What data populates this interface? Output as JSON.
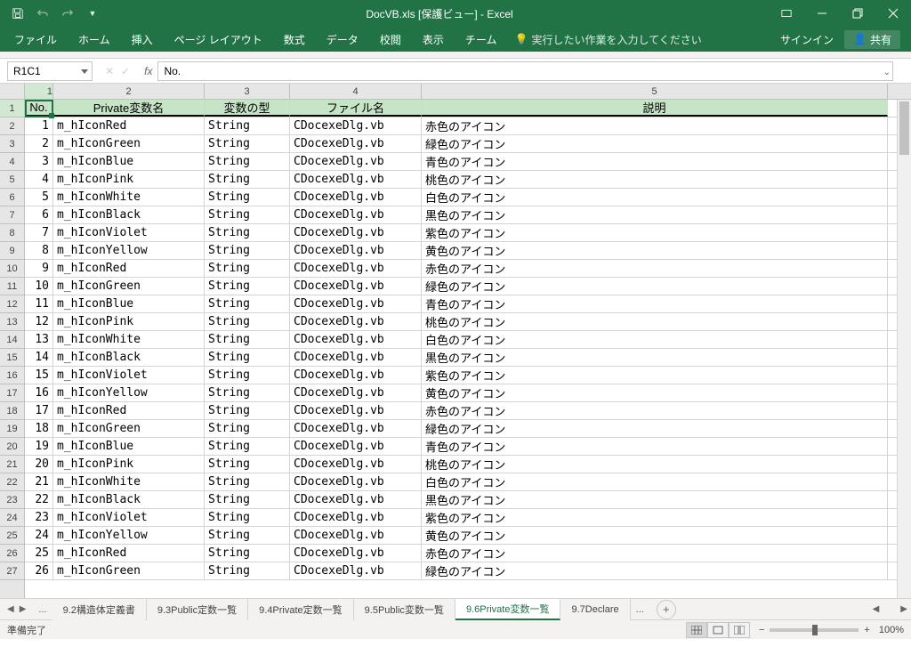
{
  "titlebar": {
    "title": "DocVB.xls [保護ビュー] - Excel"
  },
  "ribbon": {
    "tabs": [
      "ファイル",
      "ホーム",
      "挿入",
      "ページ レイアウト",
      "数式",
      "データ",
      "校閲",
      "表示",
      "チーム"
    ],
    "tell_me_placeholder": "実行したい作業を入力してください",
    "signin": "サインイン",
    "share": "共有"
  },
  "formula_bar": {
    "name_box": "R1C1",
    "formula": "No."
  },
  "grid": {
    "col_numbers": [
      "1",
      "2",
      "3",
      "4",
      "5"
    ],
    "headers": [
      "No.",
      "Private変数名",
      "変数の型",
      "ファイル名",
      "説明"
    ],
    "rows": [
      {
        "no": "1",
        "name": "m_hIconRed",
        "type": "String",
        "file": "CDocexeDlg.vb",
        "desc": "赤色のアイコン"
      },
      {
        "no": "2",
        "name": "m_hIconGreen",
        "type": "String",
        "file": "CDocexeDlg.vb",
        "desc": "緑色のアイコン"
      },
      {
        "no": "3",
        "name": "m_hIconBlue",
        "type": "String",
        "file": "CDocexeDlg.vb",
        "desc": "青色のアイコン"
      },
      {
        "no": "4",
        "name": "m_hIconPink",
        "type": "String",
        "file": "CDocexeDlg.vb",
        "desc": "桃色のアイコン"
      },
      {
        "no": "5",
        "name": "m_hIconWhite",
        "type": "String",
        "file": "CDocexeDlg.vb",
        "desc": "白色のアイコン"
      },
      {
        "no": "6",
        "name": "m_hIconBlack",
        "type": "String",
        "file": "CDocexeDlg.vb",
        "desc": "黒色のアイコン"
      },
      {
        "no": "7",
        "name": "m_hIconViolet",
        "type": "String",
        "file": "CDocexeDlg.vb",
        "desc": "紫色のアイコン"
      },
      {
        "no": "8",
        "name": "m_hIconYellow",
        "type": "String",
        "file": "CDocexeDlg.vb",
        "desc": "黄色のアイコン"
      },
      {
        "no": "9",
        "name": "m_hIconRed",
        "type": "String",
        "file": "CDocexeDlg.vb",
        "desc": "赤色のアイコン"
      },
      {
        "no": "10",
        "name": "m_hIconGreen",
        "type": "String",
        "file": "CDocexeDlg.vb",
        "desc": "緑色のアイコン"
      },
      {
        "no": "11",
        "name": "m_hIconBlue",
        "type": "String",
        "file": "CDocexeDlg.vb",
        "desc": "青色のアイコン"
      },
      {
        "no": "12",
        "name": "m_hIconPink",
        "type": "String",
        "file": "CDocexeDlg.vb",
        "desc": "桃色のアイコン"
      },
      {
        "no": "13",
        "name": "m_hIconWhite",
        "type": "String",
        "file": "CDocexeDlg.vb",
        "desc": "白色のアイコン"
      },
      {
        "no": "14",
        "name": "m_hIconBlack",
        "type": "String",
        "file": "CDocexeDlg.vb",
        "desc": "黒色のアイコン"
      },
      {
        "no": "15",
        "name": "m_hIconViolet",
        "type": "String",
        "file": "CDocexeDlg.vb",
        "desc": "紫色のアイコン"
      },
      {
        "no": "16",
        "name": "m_hIconYellow",
        "type": "String",
        "file": "CDocexeDlg.vb",
        "desc": "黄色のアイコン"
      },
      {
        "no": "17",
        "name": "m_hIconRed",
        "type": "String",
        "file": "CDocexeDlg.vb",
        "desc": "赤色のアイコン"
      },
      {
        "no": "18",
        "name": "m_hIconGreen",
        "type": "String",
        "file": "CDocexeDlg.vb",
        "desc": "緑色のアイコン"
      },
      {
        "no": "19",
        "name": "m_hIconBlue",
        "type": "String",
        "file": "CDocexeDlg.vb",
        "desc": "青色のアイコン"
      },
      {
        "no": "20",
        "name": "m_hIconPink",
        "type": "String",
        "file": "CDocexeDlg.vb",
        "desc": "桃色のアイコン"
      },
      {
        "no": "21",
        "name": "m_hIconWhite",
        "type": "String",
        "file": "CDocexeDlg.vb",
        "desc": "白色のアイコン"
      },
      {
        "no": "22",
        "name": "m_hIconBlack",
        "type": "String",
        "file": "CDocexeDlg.vb",
        "desc": "黒色のアイコン"
      },
      {
        "no": "23",
        "name": "m_hIconViolet",
        "type": "String",
        "file": "CDocexeDlg.vb",
        "desc": "紫色のアイコン"
      },
      {
        "no": "24",
        "name": "m_hIconYellow",
        "type": "String",
        "file": "CDocexeDlg.vb",
        "desc": "黄色のアイコン"
      },
      {
        "no": "25",
        "name": "m_hIconRed",
        "type": "String",
        "file": "CDocexeDlg.vb",
        "desc": "赤色のアイコン"
      },
      {
        "no": "26",
        "name": "m_hIconGreen",
        "type": "String",
        "file": "CDocexeDlg.vb",
        "desc": "緑色のアイコン"
      }
    ]
  },
  "sheet_tabs": {
    "left_hidden": "...",
    "tabs": [
      {
        "label": "9.2構造体定義書",
        "active": false
      },
      {
        "label": "9.3Public定数一覧",
        "active": false
      },
      {
        "label": "9.4Private定数一覧",
        "active": false
      },
      {
        "label": "9.5Public変数一覧",
        "active": false
      },
      {
        "label": "9.6Private変数一覧",
        "active": true
      },
      {
        "label": "9.7Declare",
        "active": false
      }
    ],
    "right_hidden": "..."
  },
  "statusbar": {
    "ready": "準備完了",
    "zoom": "100%"
  }
}
